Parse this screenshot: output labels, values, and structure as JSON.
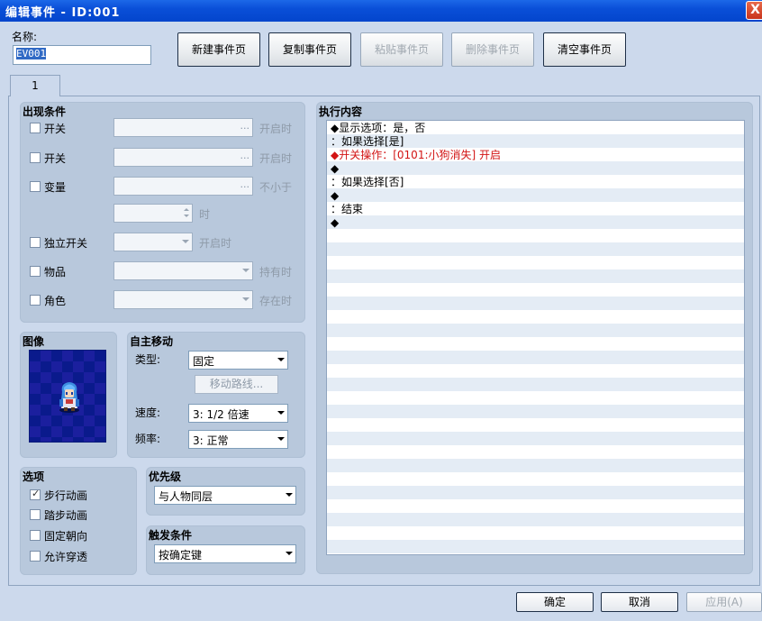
{
  "window": {
    "title": "编辑事件 - ID:001",
    "close": "X"
  },
  "name_label": "名称:",
  "name_value": "EV001",
  "toolbar": {
    "new_page": "新建事件页",
    "copy_page": "复制事件页",
    "paste_page": "粘贴事件页",
    "delete_page": "删除事件页",
    "clear_page": "清空事件页"
  },
  "tabs": [
    "1"
  ],
  "conditions": {
    "title": "出现条件",
    "switch1": {
      "label": "开关",
      "suffix": "开启时"
    },
    "switch2": {
      "label": "开关",
      "suffix": "开启时"
    },
    "variable": {
      "label": "变量",
      "suffix": "不小于",
      "spin_suffix": "时"
    },
    "self_switch": {
      "label": "独立开关",
      "suffix": "开启时"
    },
    "item": {
      "label": "物品",
      "suffix": "持有时"
    },
    "actor": {
      "label": "角色",
      "suffix": "存在时"
    },
    "dots": "..."
  },
  "image": {
    "title": "图像"
  },
  "autonomous": {
    "title": "自主移动",
    "type_label": "类型:",
    "type_value": "固定",
    "route_button": "移动路线...",
    "speed_label": "速度:",
    "speed_value": "3: 1/2 倍速",
    "freq_label": "频率:",
    "freq_value": "3: 正常"
  },
  "options": {
    "title": "选项",
    "items": [
      {
        "label": "步行动画",
        "checked": true
      },
      {
        "label": "踏步动画",
        "checked": false
      },
      {
        "label": "固定朝向",
        "checked": false
      },
      {
        "label": "允许穿透",
        "checked": false
      }
    ]
  },
  "priority": {
    "title": "优先级",
    "value": "与人物同层"
  },
  "trigger": {
    "title": "触发条件",
    "value": "按确定键"
  },
  "contents": {
    "title": "执行内容",
    "lines": [
      "◆显示选项：是，否",
      "：如果选择[是]",
      "  ◆开关操作：[0101:小狗消失] 开启",
      "  ◆",
      "：如果选择[否]",
      "  ◆",
      "：结束",
      "◆"
    ],
    "highlight_color": "#d21414"
  },
  "footer": {
    "ok": "确定",
    "cancel": "取消",
    "apply": "应用(A)"
  }
}
